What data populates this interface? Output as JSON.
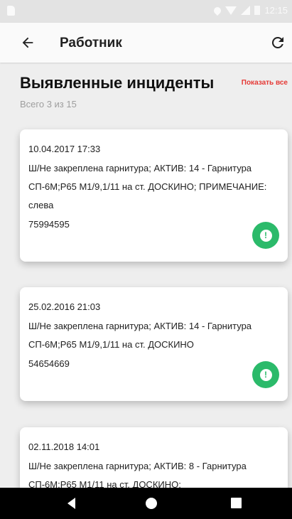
{
  "status_bar": {
    "time": "12:15"
  },
  "app_bar": {
    "title": "Работник"
  },
  "section": {
    "title": "Выявленные инциденты",
    "show_all": "Показать все",
    "total": "Всего 3 из 15"
  },
  "incidents": [
    {
      "datetime": "10.04.2017 17:33",
      "description": "Ш/Не закреплена гарнитура; АКТИВ: 14 - Гарнитура СП-6М;Р65 М1/9,1/11 на ст. ДОСКИНО; ПРИМЕЧАНИЕ: слева",
      "number": "75994595",
      "icon": "exclamation-icon"
    },
    {
      "datetime": "25.02.2016 21:03",
      "description": "Ш/Не закреплена гарнитура; АКТИВ: 14 - Гарнитура СП-6М;Р65 М1/9,1/11 на ст. ДОСКИНО",
      "number": "54654669",
      "icon": "exclamation-icon"
    },
    {
      "datetime": "02.11.2018 14:01",
      "description": "Ш/Не закреплена гарнитура; АКТИВ: 8 - Гарнитура СП-6М;Р65 М1/11 на ст. ДОСКИНО;",
      "number": "",
      "icon": "exclamation-icon"
    }
  ],
  "colors": {
    "accent_green": "#2bba6a",
    "link_red": "#e53935",
    "muted_gray": "#9e9e9e"
  }
}
